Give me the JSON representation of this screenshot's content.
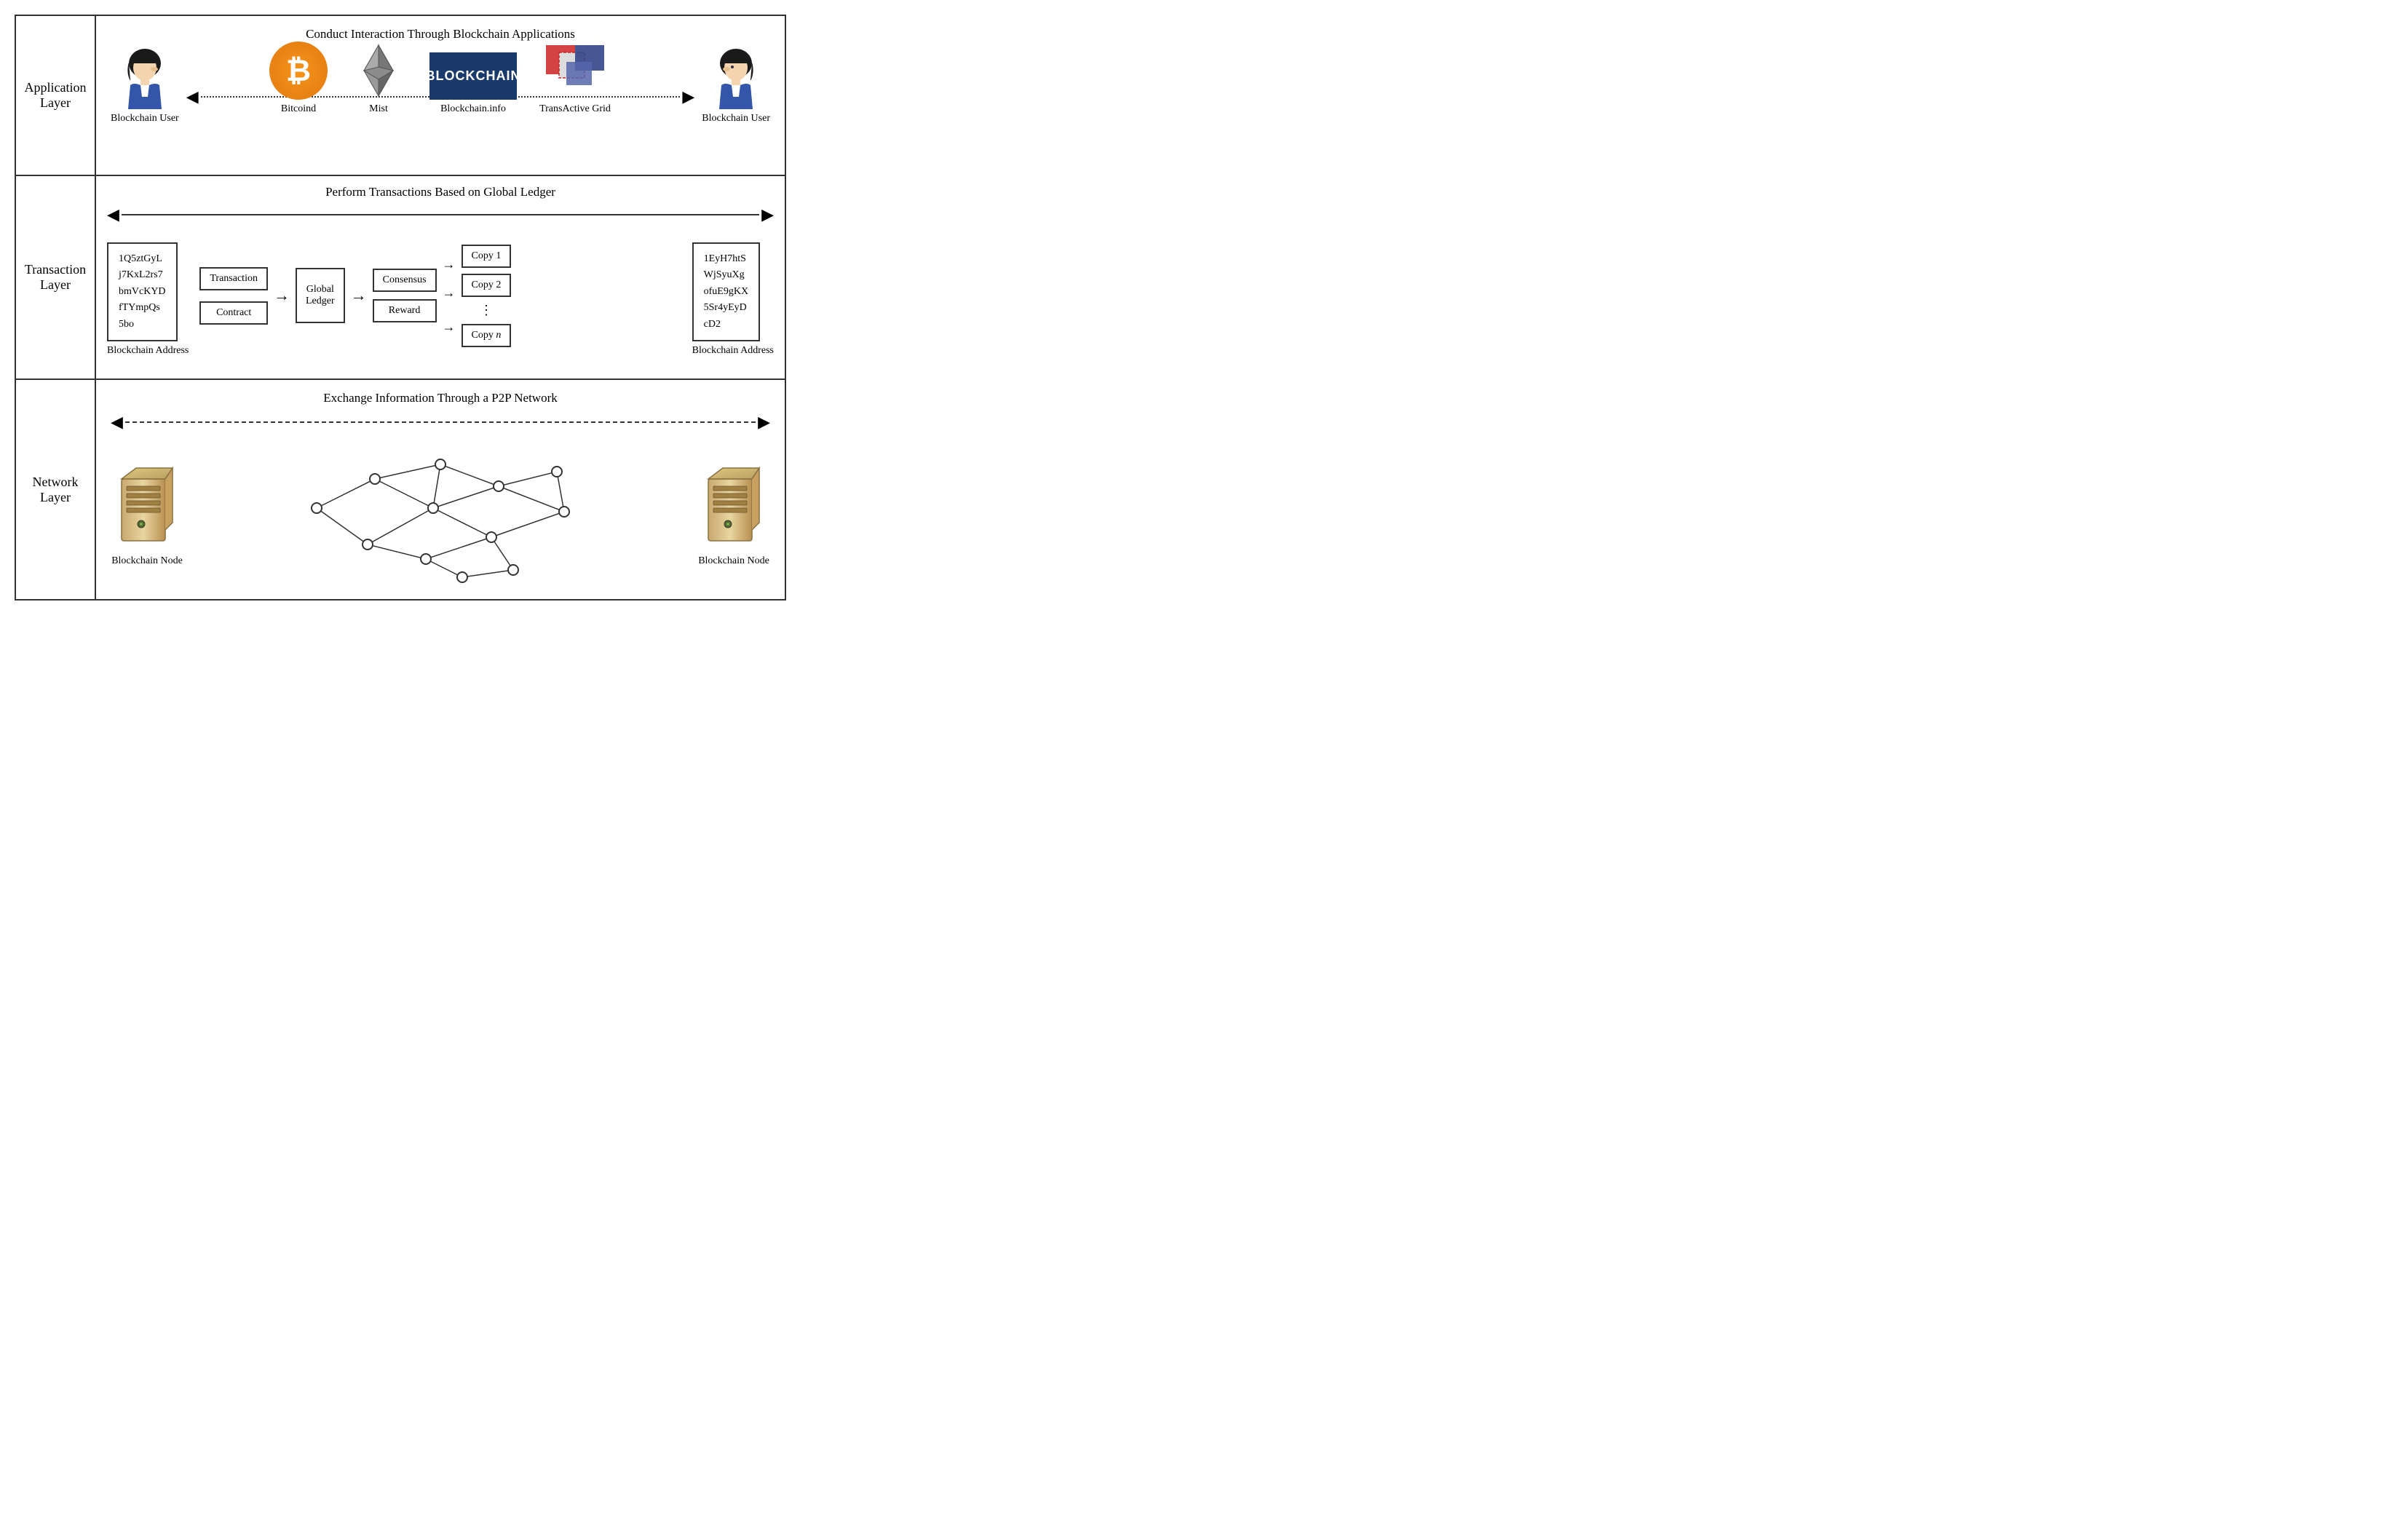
{
  "layers": {
    "application": {
      "label": "Application Layer",
      "title": "Conduct Interaction Through Blockchain Applications",
      "left_user_label": "Blockchain User",
      "right_user_label": "Blockchain User",
      "apps": [
        {
          "name": "Bitcoind",
          "type": "bitcoin"
        },
        {
          "name": "Mist",
          "type": "ethereum"
        },
        {
          "name": "Blockchain.info",
          "type": "blockchain-info"
        },
        {
          "name": "TransActive Grid",
          "type": "transactive"
        }
      ]
    },
    "transaction": {
      "label": "Transaction Layer",
      "title": "Perform Transactions Based on Global Ledger",
      "left_address": {
        "lines": [
          "1Q5ztGyL",
          "j7KxL2rs7",
          "bmVcKYD",
          "fTYmpQs",
          "5bo"
        ],
        "label": "Blockchain Address"
      },
      "right_address": {
        "lines": [
          "1EyH7htS",
          "WjSyuXg",
          "ofuE9gKX",
          "5Sr4yEyD",
          "cD2"
        ],
        "label": "Blockchain Address"
      },
      "flow": {
        "inputs": [
          "Transaction",
          "Contract"
        ],
        "global_ledger": "Global Ledger",
        "consensus": "Consensus",
        "reward": "Reward",
        "copies": [
          "Copy 1",
          "Copy 2",
          "Copy n"
        ]
      }
    },
    "network": {
      "label": "Network Layer",
      "title": "Exchange Information Through a P2P Network",
      "left_node_label": "Blockchain Node",
      "right_node_label": "Blockchain Node"
    }
  }
}
